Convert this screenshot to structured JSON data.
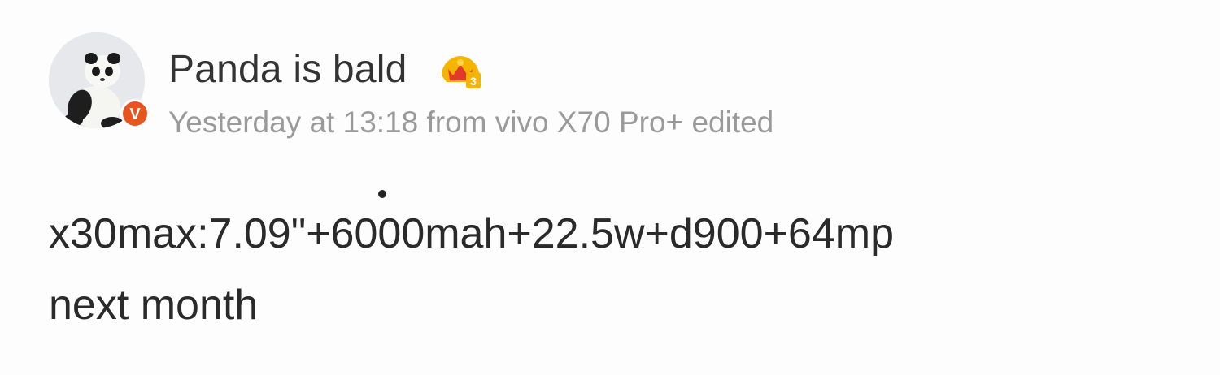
{
  "post": {
    "author": {
      "name": "Panda is bald",
      "verified_badge": "V",
      "verified_color": "#e8541e",
      "member_badge_color": "#f2a900"
    },
    "meta": {
      "time": "Yesterday at 13:18",
      "from_word": "from",
      "device": "vivo X70 Pro+",
      "edited": "edited"
    },
    "content": {
      "line1": "x30max:7.09\"+6000mah+22.5w+d900+64mp",
      "line2": "next month"
    }
  },
  "icons": {
    "avatar": "panda-plush-avatar",
    "verified": "verified-v-icon",
    "member": "crown-member-icon"
  }
}
